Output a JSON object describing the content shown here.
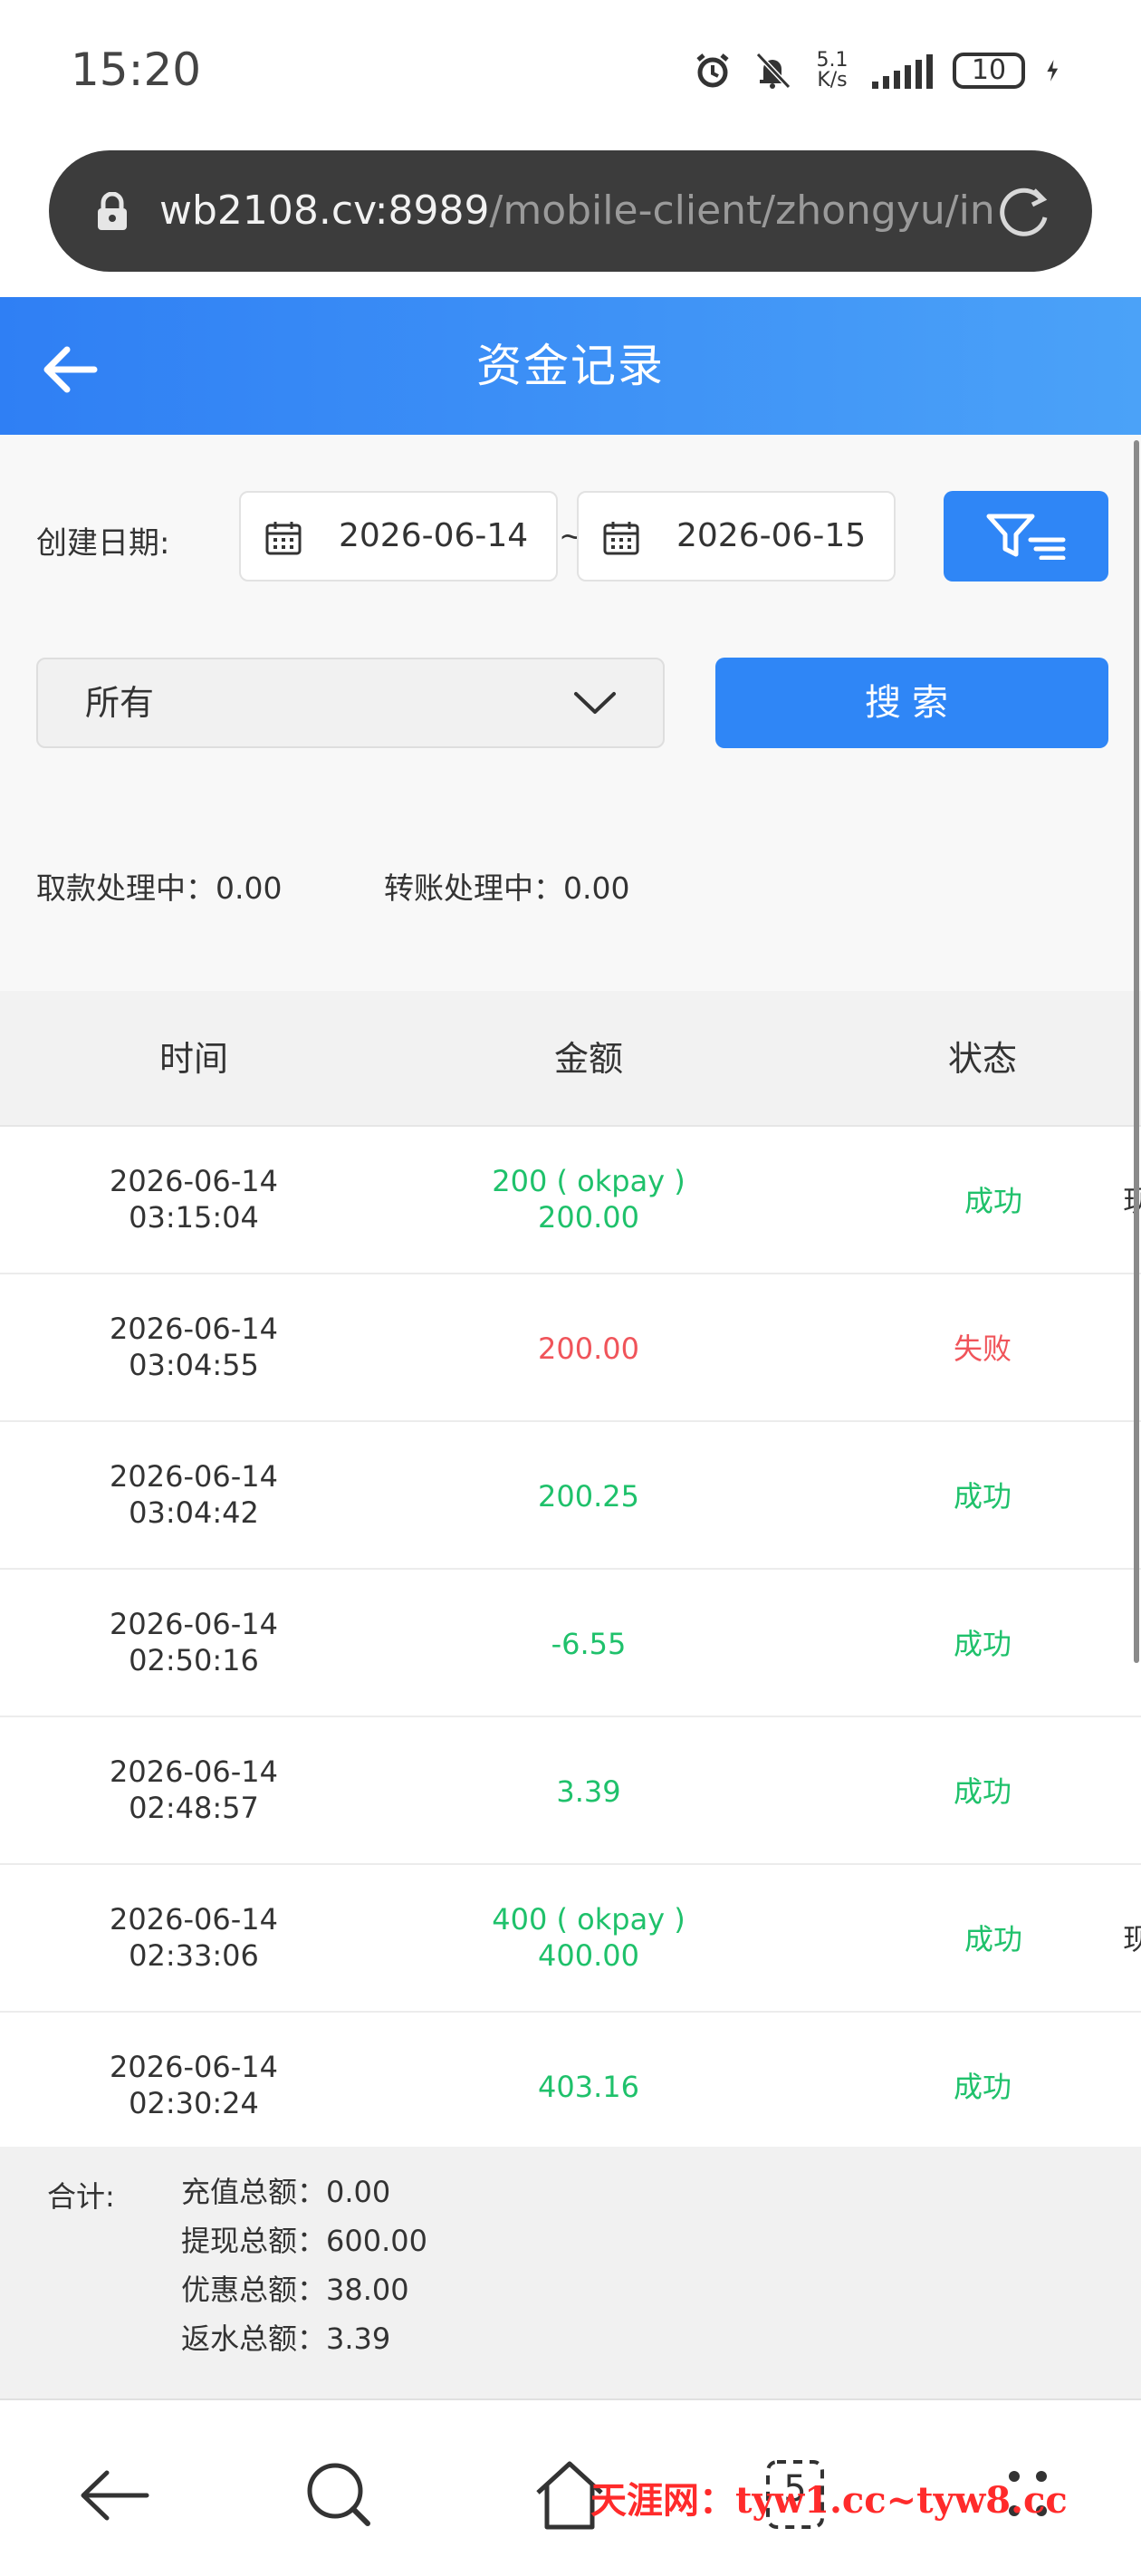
{
  "status_bar": {
    "time": "15:20",
    "net_speed_value": "5.1",
    "net_speed_unit": "K/s",
    "battery": "10"
  },
  "browser": {
    "url_host": "wb2108.cv:8989",
    "url_path": "/mobile-client/zhongyu/index"
  },
  "header": {
    "title": "资金记录"
  },
  "filters": {
    "date_label": "创建日期:",
    "date_from": "2026-06-14",
    "date_separator": "~",
    "date_to": "2026-06-15",
    "type_select": "所有",
    "search_label": "搜索",
    "withdraw_pending_label": "取款处理中：",
    "withdraw_pending_value": "0.00",
    "transfer_pending_label": "转账处理中：",
    "transfer_pending_value": "0.00"
  },
  "table": {
    "columns": [
      "时间",
      "金额",
      "状态"
    ],
    "rows": [
      {
        "date": "2026-06-14",
        "time": "03:15:04",
        "amount_line1": "200 ( okpay )",
        "amount_line2": "200.00",
        "status": "成功",
        "extra": "现"
      },
      {
        "date": "2026-06-14",
        "time": "03:04:55",
        "amount_line1": "",
        "amount_line2": "200.00",
        "status": "失败",
        "extra": ""
      },
      {
        "date": "2026-06-14",
        "time": "03:04:42",
        "amount_line1": "",
        "amount_line2": "200.25",
        "status": "成功",
        "extra": ""
      },
      {
        "date": "2026-06-14",
        "time": "02:50:16",
        "amount_line1": "",
        "amount_line2": "-6.55",
        "status": "成功",
        "extra": ""
      },
      {
        "date": "2026-06-14",
        "time": "02:48:57",
        "amount_line1": "",
        "amount_line2": "3.39",
        "status": "成功",
        "extra": ""
      },
      {
        "date": "2026-06-14",
        "time": "02:33:06",
        "amount_line1": "400 ( okpay )",
        "amount_line2": "400.00",
        "status": "成功",
        "extra": "现"
      },
      {
        "date": "2026-06-14",
        "time": "02:30:24",
        "amount_line1": "",
        "amount_line2": "403.16",
        "status": "成功",
        "extra": ""
      }
    ]
  },
  "summary": {
    "label": "合计:",
    "recharge_label": "充值总额：",
    "recharge_value": "0.00",
    "withdraw_label": "提现总额：",
    "withdraw_value": "600.00",
    "bonus_label": "优惠总额：",
    "bonus_value": "38.00",
    "rebate_label": "返水总额：",
    "rebate_value": "3.39"
  },
  "nav": {
    "tabs_count": "5"
  },
  "watermark": "天涯网：tyw1.cc~tyw8.cc",
  "colors": {
    "accent": "#2f86f6",
    "success": "#1fc16b",
    "failure": "#f0545a"
  }
}
